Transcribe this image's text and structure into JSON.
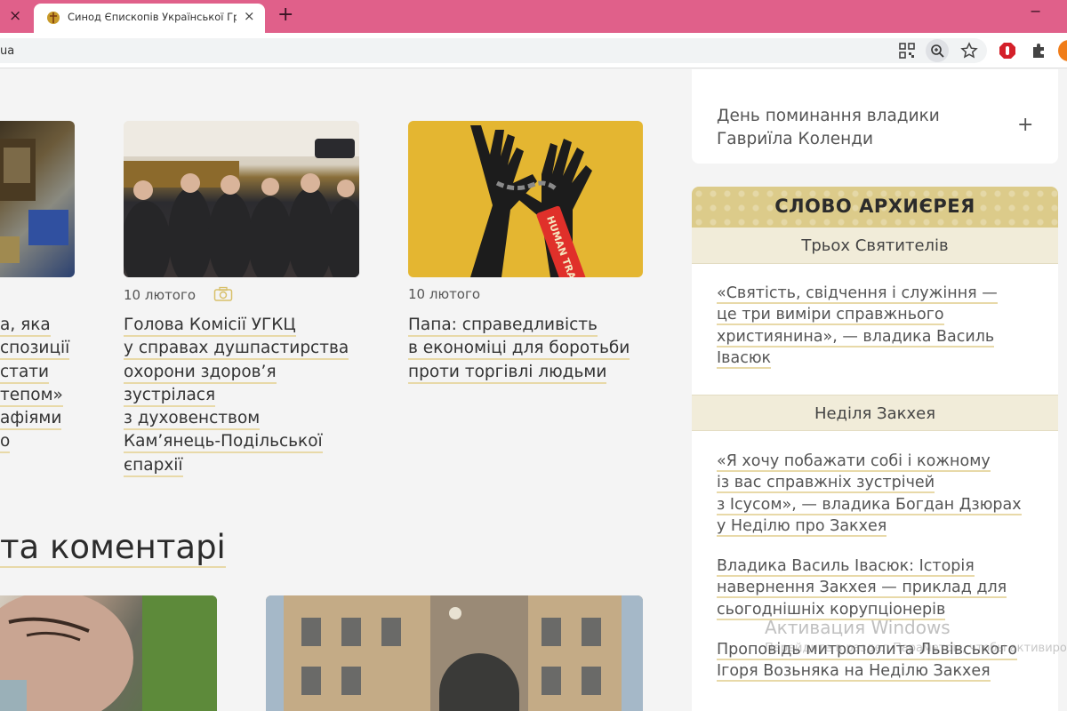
{
  "browser": {
    "prev_tab_close": "×",
    "active_tab_title": "Синод Єпископів Української Гр",
    "active_tab_close": "×",
    "new_tab": "+",
    "minimize": "−",
    "url": "ua"
  },
  "news": [
    {
      "date": "",
      "title_lines": [
        "а, яка",
        "спозиції",
        "стати",
        "тепом»",
        "афіями",
        "о"
      ]
    },
    {
      "date": "10 лютого",
      "has_camera_icon": true,
      "title_lines": [
        "Голова Комісії УГКЦ",
        "у справах душпастирства",
        "охорони здоров’я",
        "зустрілася",
        "з духовенством",
        "Кам’янець-Подільської",
        "єпархії"
      ]
    },
    {
      "date": "10 лютого",
      "title_lines": [
        "Папа: справедливість",
        "в економіці для боротьби",
        "проти торгівлі людьми"
      ]
    }
  ],
  "section_title": "та коментарі",
  "image3_text": "HUMAN TRAFFICKING",
  "sidebar": {
    "top_item_lines": [
      "День поминання владики",
      "Гавриїла Коленди"
    ],
    "top_item_toggle": "+",
    "arch_title": "СЛОВО АРХИЄРЕЯ",
    "groups": [
      {
        "header": "Трьох Святителів",
        "links": [
          [
            "«Святість, свідчення і служіння —",
            "це три виміри справжнього",
            "християнина», — владика Василь",
            "Івасюк"
          ]
        ]
      },
      {
        "header": "Неділя Закхея",
        "links": [
          [
            "«Я хочу побажати собі і кожному",
            "із вас справжніх зустрічей",
            "з Ісусом», — владика Богдан Дзюрах",
            "у Неділю про Закхея"
          ],
          [
            "Владика Василь Івасюк: Історія",
            "навернення Закхея — приклад для",
            "сьогоднішніх корупціонерів"
          ],
          [
            "Проповідь митрополита Львівського",
            "Ігоря Возьняка на Неділю Закхея"
          ]
        ]
      }
    ]
  },
  "watermark": {
    "line1": "Активация Windows",
    "line2": "Перейдите в раздел Параметры, чтобы активировать Windows."
  },
  "colors": {
    "tab_bar": "#e0608a",
    "accent_gold": "#dccb8a",
    "underline": "#e8d9a8"
  }
}
